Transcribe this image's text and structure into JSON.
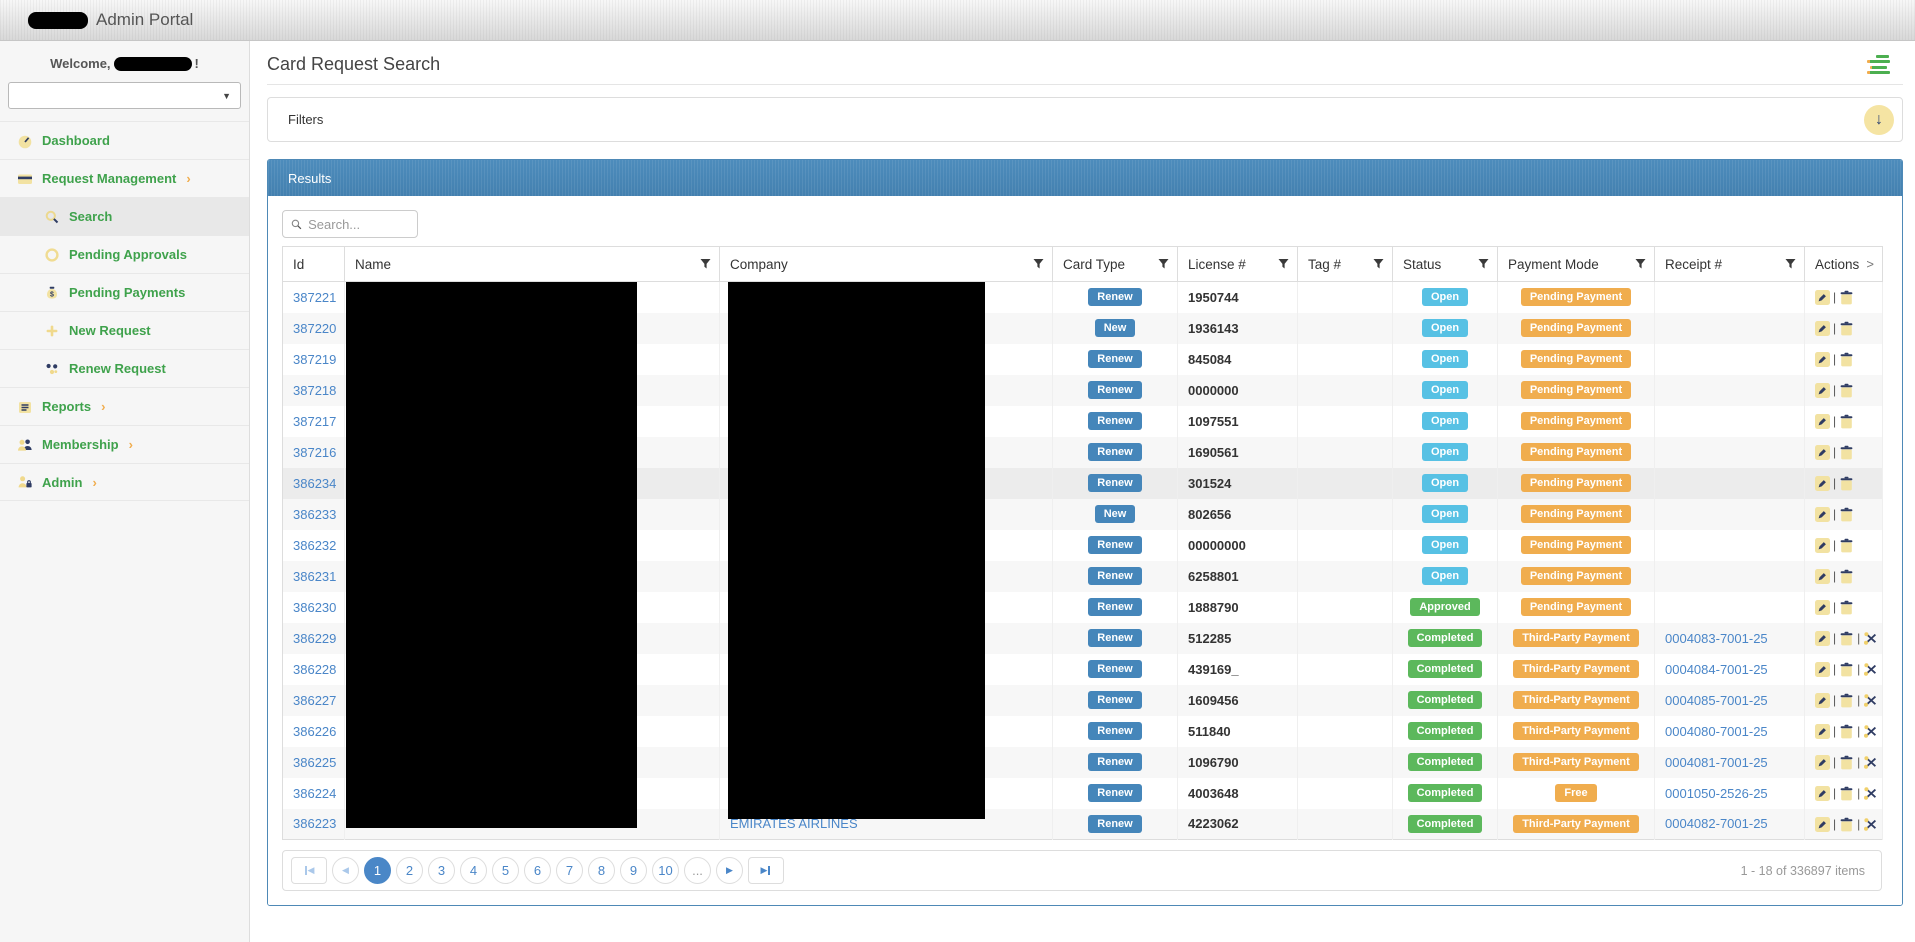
{
  "topbar": {
    "app_title": "Admin Portal"
  },
  "sidebar": {
    "welcome_prefix": "Welcome,",
    "welcome_suffix": "!",
    "items": [
      {
        "label": "Dashboard",
        "icon": "dashboard-icon",
        "level": 1,
        "active": false,
        "expandable": false
      },
      {
        "label": "Request Management",
        "icon": "credit-card-icon",
        "level": 1,
        "active": false,
        "expandable": true
      },
      {
        "label": "Search",
        "icon": "search-icon",
        "level": 2,
        "active": true,
        "expandable": false
      },
      {
        "label": "Pending Approvals",
        "icon": "circle-icon",
        "level": 2,
        "active": false,
        "expandable": false
      },
      {
        "label": "Pending Payments",
        "icon": "money-bag-icon",
        "level": 2,
        "active": false,
        "expandable": false
      },
      {
        "label": "New Request",
        "icon": "plus-icon",
        "level": 2,
        "active": false,
        "expandable": false
      },
      {
        "label": "Renew Request",
        "icon": "renew-icon",
        "level": 2,
        "active": false,
        "expandable": false
      },
      {
        "label": "Reports",
        "icon": "reports-icon",
        "level": 1,
        "active": false,
        "expandable": true
      },
      {
        "label": "Membership",
        "icon": "members-icon",
        "level": 1,
        "active": false,
        "expandable": true
      },
      {
        "label": "Admin",
        "icon": "admin-lock-icon",
        "level": 1,
        "active": false,
        "expandable": true
      }
    ]
  },
  "page": {
    "title": "Card Request Search"
  },
  "filters": {
    "label": "Filters"
  },
  "results": {
    "header": "Results",
    "search_placeholder": "Search...",
    "columns": [
      {
        "label": "Id",
        "filter": false,
        "expander": false
      },
      {
        "label": "Name",
        "filter": true,
        "expander": false
      },
      {
        "label": "Company",
        "filter": true,
        "expander": false
      },
      {
        "label": "Card Type",
        "filter": true,
        "expander": false
      },
      {
        "label": "License #",
        "filter": true,
        "expander": false
      },
      {
        "label": "Tag #",
        "filter": true,
        "expander": false
      },
      {
        "label": "Status",
        "filter": true,
        "expander": false
      },
      {
        "label": "Payment Mode",
        "filter": true,
        "expander": false
      },
      {
        "label": "Receipt #",
        "filter": true,
        "expander": false
      },
      {
        "label": "Actions",
        "filter": false,
        "expander": true
      }
    ],
    "rows": [
      {
        "id": "387221",
        "card_type": "Renew",
        "license": "1950744",
        "tag": "",
        "status": "Open",
        "payment_mode": "Pending Payment",
        "receipt": "",
        "company": "",
        "cut": false,
        "highlight": false
      },
      {
        "id": "387220",
        "card_type": "New",
        "license": "1936143",
        "tag": "",
        "status": "Open",
        "payment_mode": "Pending Payment",
        "receipt": "",
        "company": "",
        "cut": false,
        "highlight": false
      },
      {
        "id": "387219",
        "card_type": "Renew",
        "license": "845084",
        "tag": "",
        "status": "Open",
        "payment_mode": "Pending Payment",
        "receipt": "",
        "company": "",
        "cut": false,
        "highlight": false
      },
      {
        "id": "387218",
        "card_type": "Renew",
        "license": "0000000",
        "tag": "",
        "status": "Open",
        "payment_mode": "Pending Payment",
        "receipt": "",
        "company": "",
        "cut": false,
        "highlight": false
      },
      {
        "id": "387217",
        "card_type": "Renew",
        "license": "1097551",
        "tag": "",
        "status": "Open",
        "payment_mode": "Pending Payment",
        "receipt": "",
        "company": "",
        "cut": false,
        "highlight": false
      },
      {
        "id": "387216",
        "card_type": "Renew",
        "license": "1690561",
        "tag": "",
        "status": "Open",
        "payment_mode": "Pending Payment",
        "receipt": "",
        "company": "",
        "cut": false,
        "highlight": false
      },
      {
        "id": "386234",
        "card_type": "Renew",
        "license": "301524",
        "tag": "",
        "status": "Open",
        "payment_mode": "Pending Payment",
        "receipt": "",
        "company": "",
        "cut": false,
        "highlight": true
      },
      {
        "id": "386233",
        "card_type": "New",
        "license": "802656",
        "tag": "",
        "status": "Open",
        "payment_mode": "Pending Payment",
        "receipt": "",
        "company": "",
        "cut": false,
        "highlight": false
      },
      {
        "id": "386232",
        "card_type": "Renew",
        "license": "00000000",
        "tag": "",
        "status": "Open",
        "payment_mode": "Pending Payment",
        "receipt": "",
        "company": "",
        "cut": false,
        "highlight": false
      },
      {
        "id": "386231",
        "card_type": "Renew",
        "license": "6258801",
        "tag": "",
        "status": "Open",
        "payment_mode": "Pending Payment",
        "receipt": "",
        "company": "",
        "cut": false,
        "highlight": false
      },
      {
        "id": "386230",
        "card_type": "Renew",
        "license": "1888790",
        "tag": "",
        "status": "Approved",
        "payment_mode": "Pending Payment",
        "receipt": "",
        "company": "",
        "cut": false,
        "highlight": false
      },
      {
        "id": "386229",
        "card_type": "Renew",
        "license": "512285",
        "tag": "",
        "status": "Completed",
        "payment_mode": "Third-Party Payment",
        "receipt": "0004083-7001-25",
        "company": "",
        "cut": true,
        "highlight": false
      },
      {
        "id": "386228",
        "card_type": "Renew",
        "license": "439169_",
        "tag": "",
        "status": "Completed",
        "payment_mode": "Third-Party Payment",
        "receipt": "0004084-7001-25",
        "company": "",
        "cut": true,
        "highlight": false
      },
      {
        "id": "386227",
        "card_type": "Renew",
        "license": "1609456",
        "tag": "",
        "status": "Completed",
        "payment_mode": "Third-Party Payment",
        "receipt": "0004085-7001-25",
        "company": "",
        "cut": true,
        "highlight": false
      },
      {
        "id": "386226",
        "card_type": "Renew",
        "license": "511840",
        "tag": "",
        "status": "Completed",
        "payment_mode": "Third-Party Payment",
        "receipt": "0004080-7001-25",
        "company": "",
        "cut": true,
        "highlight": false
      },
      {
        "id": "386225",
        "card_type": "Renew",
        "license": "1096790",
        "tag": "",
        "status": "Completed",
        "payment_mode": "Third-Party Payment",
        "receipt": "0004081-7001-25",
        "company": "",
        "cut": true,
        "highlight": false
      },
      {
        "id": "386224",
        "card_type": "Renew",
        "license": "4003648",
        "tag": "",
        "status": "Completed",
        "payment_mode": "Free",
        "receipt": "0001050-2526-25",
        "company": "",
        "cut": true,
        "highlight": false
      },
      {
        "id": "386223",
        "card_type": "Renew",
        "license": "4223062",
        "tag": "",
        "status": "Completed",
        "payment_mode": "Third-Party Payment",
        "receipt": "0004082-7001-25",
        "company": "EMIRATES AIRLINES",
        "cut": true,
        "highlight": false
      }
    ],
    "pager": {
      "pages": [
        "1",
        "2",
        "3",
        "4",
        "5",
        "6",
        "7",
        "8",
        "9",
        "10",
        "..."
      ],
      "active": "1",
      "info": "1 - 18 of 336897 items"
    }
  },
  "colors": {
    "panel_blue": "#4e89b6",
    "badge_card_blue": "#4586ba",
    "status_open_blue": "#57c1e4",
    "status_green": "#5cb85c",
    "payment_orange": "#f0ad4e",
    "link_blue": "#4a86c8",
    "menu_green": "#3fa24c",
    "icon_yellow": "#f2e2a2",
    "icon_navy": "#2f3c63"
  }
}
